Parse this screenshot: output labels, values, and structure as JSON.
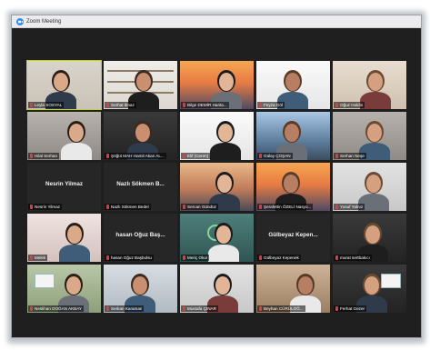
{
  "window": {
    "title": "Zoom Meeting",
    "accent_color": "#2d8cff",
    "active_speaker_color": "#c8d600",
    "muted_color": "#e33b3b"
  },
  "participants": [
    {
      "name": "Leyla SOSYAL",
      "video": true,
      "scene": "room1",
      "active": true
    },
    {
      "name": "Serhat Ilmaz",
      "video": true,
      "scene": "shelf"
    },
    {
      "name": "Bilge DEMİR Harita...",
      "video": true,
      "scene": "bridge"
    },
    {
      "name": "Feyza Göl",
      "video": true,
      "scene": "white"
    },
    {
      "name": "Oğuz Holdin",
      "video": true,
      "scene": "beige"
    },
    {
      "name": "Hilal Serhan",
      "video": true,
      "scene": "grey"
    },
    {
      "name": "Şöğüt MAH Hamit Akan AL...",
      "video": true,
      "scene": "dark"
    },
    {
      "name": "Elif (Ceren)",
      "video": true,
      "scene": "white"
    },
    {
      "name": "Gülay ÇOŞAN",
      "video": true,
      "scene": "city"
    },
    {
      "name": "Serhan Neşe",
      "video": true,
      "scene": "grey"
    },
    {
      "name": "Nesrin Yilmaz",
      "video": false,
      "center_label": "Nesrin Yilmaz"
    },
    {
      "name": "Nazlı Sökmen Bedel",
      "video": false,
      "center_label": "Nazlı Sökmen B..."
    },
    {
      "name": "Sercan Gündüz",
      "video": true,
      "scene": "sunset2"
    },
    {
      "name": "Şerafettin ÖZELİ Nasyo...",
      "video": true,
      "scene": "bridge"
    },
    {
      "name": "Yusuf Yalnız",
      "video": true,
      "scene": "wall"
    },
    {
      "name": "Melek",
      "video": true,
      "scene": "pink"
    },
    {
      "name": "hasan Oğuz Başbulsu",
      "video": false,
      "center_label": "hasan Oğuz Baş..."
    },
    {
      "name": "Meriç Okur",
      "video": true,
      "scene": "teal"
    },
    {
      "name": "Gülbeyaz Kepenek",
      "video": false,
      "center_label": "Gülbeyaz Kepen..."
    },
    {
      "name": "murat sertbakıcı",
      "video": true,
      "scene": "dark"
    },
    {
      "name": "Neslihan DOĞAN AKBAY",
      "video": true,
      "scene": "green"
    },
    {
      "name": "Serkan Karaman",
      "video": true,
      "scene": "office"
    },
    {
      "name": "Mustafa ÇINAR",
      "video": true,
      "scene": "wall"
    },
    {
      "name": "Beyhan CÜRÜLOĞ...",
      "video": true,
      "scene": "wood"
    },
    {
      "name": "Ferhat Gezer",
      "video": true,
      "scene": "dark"
    }
  ]
}
